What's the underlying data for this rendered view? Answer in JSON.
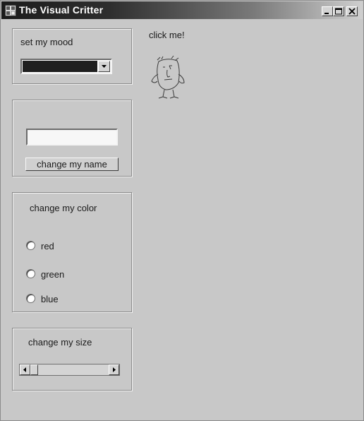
{
  "window": {
    "title": "The Visual Critter"
  },
  "title_buttons": {
    "minimize_icon": "minimize-icon",
    "maximize_icon": "maximize-icon",
    "close_icon": "close-icon"
  },
  "mood_group": {
    "label": "set my mood",
    "selected_value": ""
  },
  "name_group": {
    "input_value": "",
    "button_label": "change my name"
  },
  "color_group": {
    "label": "change my color",
    "options": [
      {
        "label": "red",
        "selected": false
      },
      {
        "label": "green",
        "selected": false
      },
      {
        "label": "blue",
        "selected": false
      }
    ]
  },
  "size_group": {
    "label": "change my size",
    "scroll_level": 0
  },
  "critter": {
    "prompt": "click me!",
    "icon": "critter-icon"
  },
  "colors": {
    "window_bg": "#c8c8c8",
    "titlebar_dark": "#1c1c1c",
    "combo_fill": "#1f1f1f"
  }
}
